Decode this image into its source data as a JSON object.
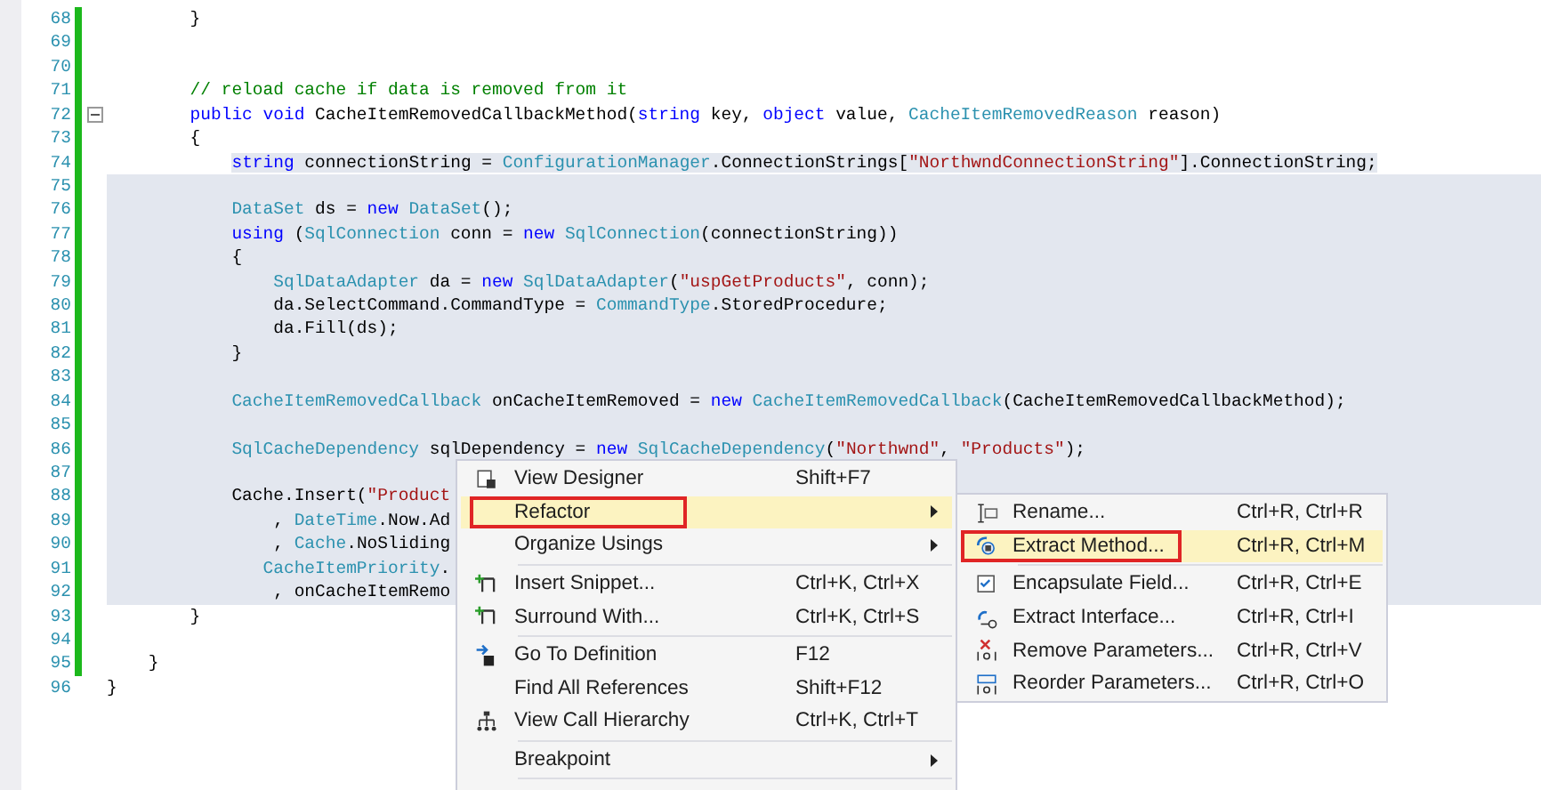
{
  "editor": {
    "lines": [
      {
        "number": "68",
        "changed": true,
        "selected": false,
        "foldable": false,
        "tokens": [
          {
            "kind": "plain",
            "t": "        }"
          }
        ]
      },
      {
        "number": "69",
        "changed": true,
        "selected": false,
        "foldable": false
      },
      {
        "number": "70",
        "changed": true,
        "selected": false,
        "foldable": false
      },
      {
        "number": "71",
        "changed": true,
        "selected": false,
        "foldable": false,
        "tokens": [
          {
            "kind": "comment",
            "t": "        // reload cache if data is removed from it"
          }
        ]
      },
      {
        "number": "72",
        "changed": true,
        "selected": false,
        "foldable": true,
        "tokens": [
          {
            "kind": "keyword",
            "t": "        public void"
          },
          {
            "kind": "plain",
            "t": " CacheItemRemovedCallbackMethod("
          },
          {
            "kind": "keyword",
            "t": "string"
          },
          {
            "kind": "plain",
            "t": " key, "
          },
          {
            "kind": "keyword",
            "t": "object"
          },
          {
            "kind": "plain",
            "t": " value, "
          },
          {
            "kind": "type",
            "t": "CacheItemRemovedReason"
          },
          {
            "kind": "plain",
            "t": " reason)"
          }
        ]
      },
      {
        "number": "73",
        "changed": true,
        "selected": false,
        "foldable": false,
        "tokens": [
          {
            "kind": "plain",
            "t": "        {"
          }
        ]
      },
      {
        "number": "74",
        "changed": true,
        "selected": true,
        "foldable": false,
        "tokens": [
          {
            "kind": "keyword",
            "t": "            string"
          },
          {
            "kind": "plain",
            "t": " connectionString = "
          },
          {
            "kind": "type",
            "t": "ConfigurationManager"
          },
          {
            "kind": "plain",
            "t": ".ConnectionStrings["
          },
          {
            "kind": "string",
            "t": "\"NorthwndConnectionString\""
          },
          {
            "kind": "plain",
            "t": "].ConnectionString;"
          }
        ]
      },
      {
        "number": "75",
        "changed": true,
        "selected": true,
        "foldable": false
      },
      {
        "number": "76",
        "changed": true,
        "selected": true,
        "foldable": false,
        "tokens": [
          {
            "kind": "type",
            "t": "            DataSet"
          },
          {
            "kind": "plain",
            "t": " ds = "
          },
          {
            "kind": "keyword",
            "t": "new"
          },
          {
            "kind": "type",
            "t": " DataSet"
          },
          {
            "kind": "plain",
            "t": "();"
          }
        ]
      },
      {
        "number": "77",
        "changed": true,
        "selected": true,
        "foldable": false,
        "tokens": [
          {
            "kind": "keyword",
            "t": "            using"
          },
          {
            "kind": "plain",
            "t": " ("
          },
          {
            "kind": "type",
            "t": "SqlConnection"
          },
          {
            "kind": "plain",
            "t": " conn = "
          },
          {
            "kind": "keyword",
            "t": "new"
          },
          {
            "kind": "type",
            "t": " SqlConnection"
          },
          {
            "kind": "plain",
            "t": "(connectionString))"
          }
        ]
      },
      {
        "number": "78",
        "changed": true,
        "selected": true,
        "foldable": false,
        "tokens": [
          {
            "kind": "plain",
            "t": "            {"
          }
        ]
      },
      {
        "number": "79",
        "changed": true,
        "selected": true,
        "foldable": false,
        "tokens": [
          {
            "kind": "type",
            "t": "                SqlDataAdapter"
          },
          {
            "kind": "plain",
            "t": " da = "
          },
          {
            "kind": "keyword",
            "t": "new"
          },
          {
            "kind": "type",
            "t": " SqlDataAdapter"
          },
          {
            "kind": "plain",
            "t": "("
          },
          {
            "kind": "string",
            "t": "\"uspGetProducts\""
          },
          {
            "kind": "plain",
            "t": ", conn);"
          }
        ]
      },
      {
        "number": "80",
        "changed": true,
        "selected": true,
        "foldable": false,
        "tokens": [
          {
            "kind": "plain",
            "t": "                da.SelectCommand.CommandType = "
          },
          {
            "kind": "type",
            "t": "CommandType"
          },
          {
            "kind": "plain",
            "t": ".StoredProcedure;"
          }
        ]
      },
      {
        "number": "81",
        "changed": true,
        "selected": true,
        "foldable": false,
        "tokens": [
          {
            "kind": "plain",
            "t": "                da.Fill(ds);"
          }
        ]
      },
      {
        "number": "82",
        "changed": true,
        "selected": true,
        "foldable": false,
        "tokens": [
          {
            "kind": "plain",
            "t": "            }"
          }
        ]
      },
      {
        "number": "83",
        "changed": true,
        "selected": true,
        "foldable": false
      },
      {
        "number": "84",
        "changed": true,
        "selected": true,
        "foldable": false,
        "tokens": [
          {
            "kind": "type",
            "t": "            CacheItemRemovedCallback"
          },
          {
            "kind": "plain",
            "t": " onCacheItemRemoved = "
          },
          {
            "kind": "keyword",
            "t": "new"
          },
          {
            "kind": "type",
            "t": " CacheItemRemovedCallback"
          },
          {
            "kind": "plain",
            "t": "(CacheItemRemovedCallbackMethod);"
          }
        ]
      },
      {
        "number": "85",
        "changed": true,
        "selected": true,
        "foldable": false
      },
      {
        "number": "86",
        "changed": true,
        "selected": true,
        "foldable": false,
        "tokens": [
          {
            "kind": "type",
            "t": "            SqlCacheDependency"
          },
          {
            "kind": "plain",
            "t": " sqlDependency = "
          },
          {
            "kind": "keyword",
            "t": "new"
          },
          {
            "kind": "type",
            "t": " SqlCacheDependency"
          },
          {
            "kind": "plain",
            "t": "("
          },
          {
            "kind": "string",
            "t": "\"Northwnd\""
          },
          {
            "kind": "plain",
            "t": ", "
          },
          {
            "kind": "string",
            "t": "\"Products\""
          },
          {
            "kind": "plain",
            "t": ");"
          }
        ]
      },
      {
        "number": "87",
        "changed": true,
        "selected": true,
        "foldable": false
      },
      {
        "number": "88",
        "changed": true,
        "selected": true,
        "foldable": false,
        "tokens": [
          {
            "kind": "plain",
            "t": "            Cache.Insert("
          },
          {
            "kind": "string",
            "t": "\"Product"
          }
        ]
      },
      {
        "number": "89",
        "changed": true,
        "selected": true,
        "foldable": false,
        "tokens": [
          {
            "kind": "plain",
            "t": "                , "
          },
          {
            "kind": "type",
            "t": "DateTime"
          },
          {
            "kind": "plain",
            "t": ".Now.Ad"
          }
        ]
      },
      {
        "number": "90",
        "changed": true,
        "selected": true,
        "foldable": false,
        "tokens": [
          {
            "kind": "plain",
            "t": "                , "
          },
          {
            "kind": "type",
            "t": "Cache"
          },
          {
            "kind": "plain",
            "t": ".NoSliding"
          }
        ]
      },
      {
        "number": "91",
        "changed": true,
        "selected": true,
        "foldable": false,
        "tokens": [
          {
            "kind": "type",
            "t": "               CacheItemPriority"
          },
          {
            "kind": "plain",
            "t": "."
          }
        ]
      },
      {
        "number": "92",
        "changed": true,
        "selected": true,
        "foldable": false,
        "tokens": [
          {
            "kind": "plain",
            "t": "                , onCacheItemRemo"
          }
        ]
      },
      {
        "number": "93",
        "changed": true,
        "selected": false,
        "foldable": false,
        "tokens": [
          {
            "kind": "plain",
            "t": "        }"
          }
        ]
      },
      {
        "number": "94",
        "changed": true,
        "selected": false,
        "foldable": false
      },
      {
        "number": "95",
        "changed": true,
        "selected": false,
        "foldable": false,
        "tokens": [
          {
            "kind": "plain",
            "t": "    }"
          }
        ]
      },
      {
        "number": "96",
        "changed": false,
        "selected": false,
        "foldable": false,
        "tokens": [
          {
            "kind": "plain",
            "t": "}"
          }
        ]
      }
    ]
  },
  "context_menu": {
    "items": [
      {
        "kind": "item",
        "label": "View Designer",
        "shortcut": "Shift+F7",
        "submenu": false,
        "selected": false,
        "outlined": false
      },
      {
        "kind": "item",
        "label": "Refactor",
        "submenu": true,
        "selected": true,
        "outlined": true
      },
      {
        "kind": "item",
        "label": "Organize Usings",
        "submenu": true,
        "selected": false,
        "outlined": false
      },
      {
        "kind": "separator"
      },
      {
        "kind": "item",
        "label": "Insert Snippet...",
        "shortcut": "Ctrl+K, Ctrl+X",
        "submenu": false,
        "selected": false,
        "outlined": false
      },
      {
        "kind": "item",
        "label": "Surround With...",
        "shortcut": "Ctrl+K, Ctrl+S",
        "submenu": false,
        "selected": false,
        "outlined": false
      },
      {
        "kind": "separator"
      },
      {
        "kind": "item",
        "label": "Go To Definition",
        "shortcut": "F12",
        "submenu": false,
        "selected": false,
        "outlined": false
      },
      {
        "kind": "item",
        "label": "Find All References",
        "shortcut": "Shift+F12",
        "submenu": false,
        "selected": false,
        "outlined": false
      },
      {
        "kind": "item",
        "label": "View Call Hierarchy",
        "shortcut": "Ctrl+K, Ctrl+T",
        "submenu": false,
        "selected": false,
        "outlined": false
      },
      {
        "kind": "separator"
      },
      {
        "kind": "item",
        "label": "Breakpoint",
        "submenu": true,
        "selected": false,
        "outlined": false
      },
      {
        "kind": "separator"
      }
    ]
  },
  "refactor_submenu": {
    "items": [
      {
        "kind": "item",
        "label": "Rename...",
        "shortcut": "Ctrl+R, Ctrl+R",
        "selected": false,
        "outlined": false
      },
      {
        "kind": "item",
        "label": "Extract Method...",
        "shortcut": "Ctrl+R, Ctrl+M",
        "selected": true,
        "outlined": true
      },
      {
        "kind": "separator"
      },
      {
        "kind": "item",
        "label": "Encapsulate Field...",
        "shortcut": "Ctrl+R, Ctrl+E",
        "selected": false,
        "outlined": false
      },
      {
        "kind": "item",
        "label": "Extract Interface...",
        "shortcut": "Ctrl+R, Ctrl+I",
        "selected": false,
        "outlined": false
      },
      {
        "kind": "item",
        "label": "Remove Parameters...",
        "shortcut": "Ctrl+R, Ctrl+V",
        "selected": false,
        "outlined": false
      },
      {
        "kind": "item",
        "label": "Reorder Parameters...",
        "shortcut": "Ctrl+R, Ctrl+O",
        "selected": false,
        "outlined": false
      }
    ]
  }
}
